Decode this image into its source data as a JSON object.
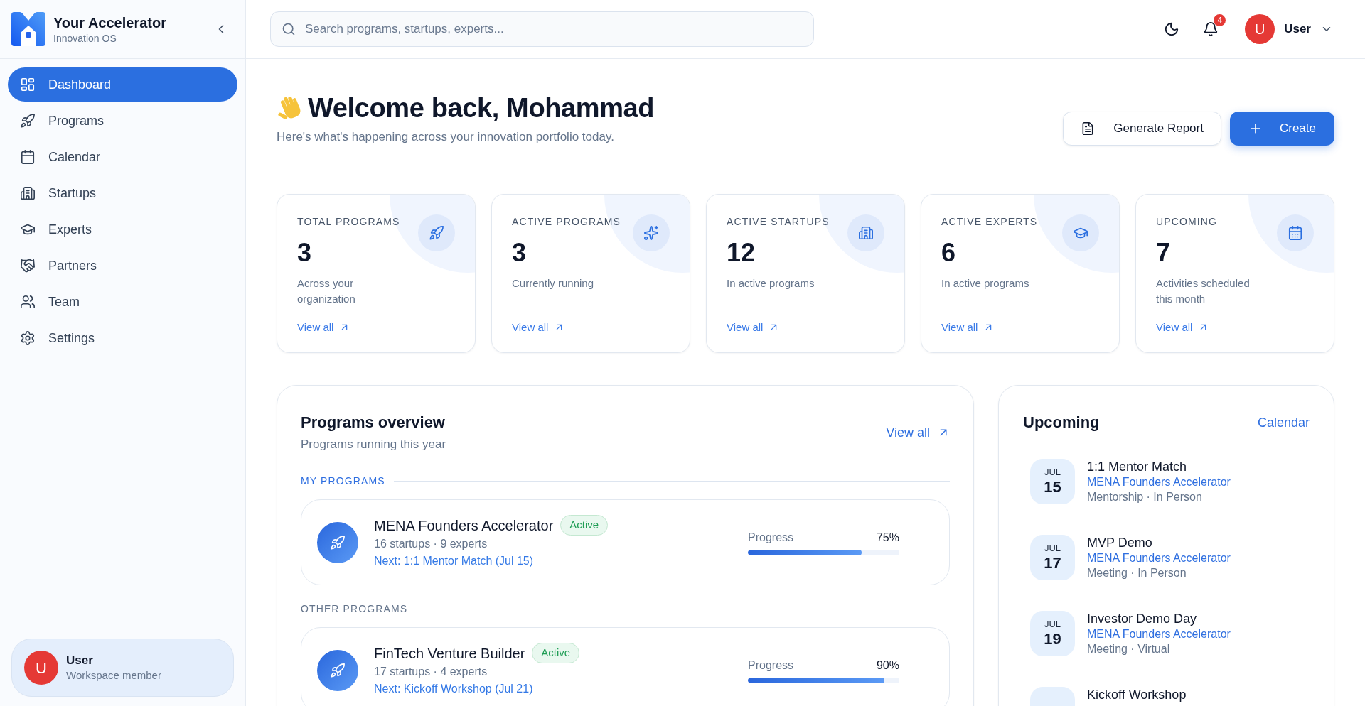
{
  "sidebar": {
    "brand": {
      "title": "Your Accelerator",
      "subtitle": "Innovation OS"
    },
    "nav": [
      {
        "label": "Dashboard",
        "selected": true
      },
      {
        "label": "Programs",
        "selected": false
      },
      {
        "label": "Calendar",
        "selected": false
      },
      {
        "label": "Startups",
        "selected": false
      },
      {
        "label": "Experts",
        "selected": false
      },
      {
        "label": "Partners",
        "selected": false
      },
      {
        "label": "Team",
        "selected": false
      },
      {
        "label": "Settings",
        "selected": false
      }
    ],
    "user": {
      "initial": "U",
      "name": "User",
      "role": "Workspace member"
    }
  },
  "header": {
    "search": {
      "placeholder": "Search programs, startups, experts..."
    },
    "notifications": {
      "count": "4"
    },
    "user": {
      "initial": "U",
      "name": "User"
    }
  },
  "welcome": {
    "title": "Welcome back, Mohammad",
    "subtitle": "Here's what's happening across your innovation portfolio today."
  },
  "actions": [
    {
      "kind": "secondary",
      "label": "Generate Report"
    },
    {
      "kind": "primary",
      "label": "Create"
    }
  ],
  "stats": [
    {
      "label": "TOTAL PROGRAMS",
      "value": "3",
      "description": "Across your organization",
      "link": "View all"
    },
    {
      "label": "ACTIVE PROGRAMS",
      "value": "3",
      "description": "Currently running",
      "link": "View all"
    },
    {
      "label": "ACTIVE STARTUPS",
      "value": "12",
      "description": "In active programs",
      "link": "View all"
    },
    {
      "label": "ACTIVE EXPERTS",
      "value": "6",
      "description": "In active programs",
      "link": "View all"
    },
    {
      "label": "UPCOMING",
      "value": "7",
      "description": "Activities scheduled this month",
      "link": "View all"
    }
  ],
  "programs_overview": {
    "title": "Programs overview",
    "subtitle": "Programs running this year",
    "link": "View all",
    "groups": [
      {
        "label": "MY PROGRAMS",
        "color": "#2f6fe0",
        "programs": [
          {
            "name": "MENA Founders Accelerator",
            "status": "Active",
            "meta": "16 startups · 9 experts",
            "next": "Next: 1:1 Mentor Match (Jul 15)",
            "progress_label": "Progress",
            "reading": "75%",
            "level": 0.75
          }
        ]
      },
      {
        "label": "OTHER PROGRAMS",
        "color": "#64748b",
        "programs": [
          {
            "name": "FinTech Venture Builder",
            "status": "Active",
            "meta": "17 startups · 4 experts",
            "next": "Next: Kickoff Workshop (Jul 21)",
            "progress_label": "Progress",
            "reading": "90%",
            "level": 0.9
          }
        ]
      }
    ]
  },
  "upcoming": {
    "title": "Upcoming",
    "link": "Calendar",
    "events": [
      {
        "month": "JUL",
        "day": "15",
        "title": "1:1 Mentor Match",
        "program": "MENA Founders Accelerator",
        "details": "Mentorship · In Person"
      },
      {
        "month": "JUL",
        "day": "17",
        "title": "MVP Demo",
        "program": "MENA Founders Accelerator",
        "details": "Meeting · In Person"
      },
      {
        "month": "JUL",
        "day": "19",
        "title": "Investor Demo Day",
        "program": "MENA Founders Accelerator",
        "details": "Meeting · Virtual"
      },
      {
        "title": "Kickoff Workshop"
      }
    ]
  }
}
